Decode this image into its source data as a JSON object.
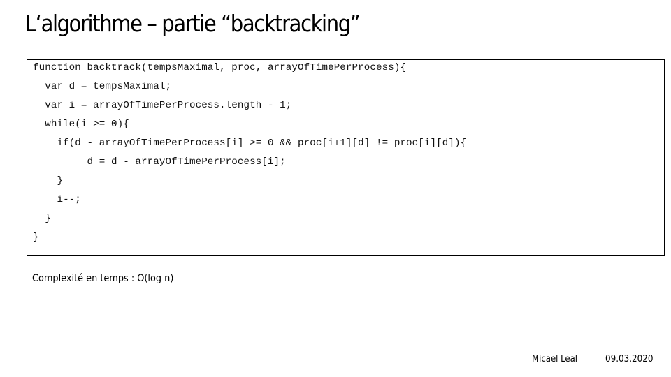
{
  "slide": {
    "title": "L‘algorithme – partie “backtracking”",
    "code_lines": [
      "function backtrack(tempsMaximal, proc, arrayOfTimePerProcess){",
      "  var d = tempsMaximal;",
      "  var i = arrayOfTimePerProcess.length - 1;",
      "  while(i >= 0){",
      "    if(d - arrayOfTimePerProcess[i] >= 0 && proc[i+1][d] != proc[i][d]){",
      "         d = d - arrayOfTimePerProcess[i];",
      "    }",
      "    i--;",
      "  }",
      "}"
    ],
    "complexity": "Complexité en temps : O(log n)",
    "footer": {
      "author": "Micael Leal",
      "date": "09.03.2020"
    }
  }
}
